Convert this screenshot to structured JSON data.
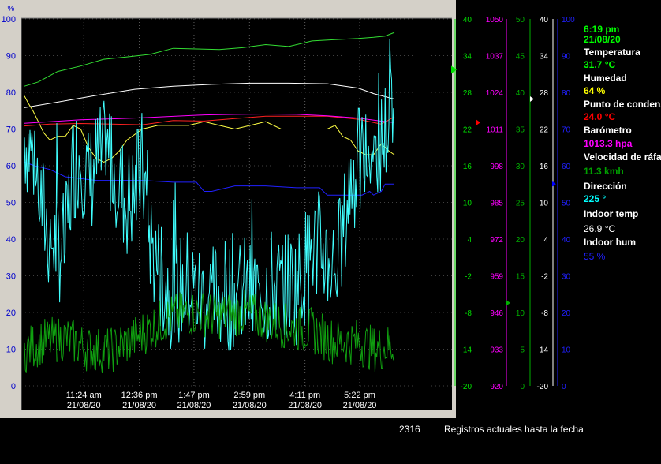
{
  "chart_data": {
    "type": "line",
    "left_axis": {
      "unit": "%",
      "ticks": [
        "100",
        "90",
        "80",
        "70",
        "60",
        "50",
        "40",
        "30",
        "20",
        "10",
        "0"
      ],
      "ylim": [
        0,
        100
      ]
    },
    "right_axes": [
      {
        "name": "temp",
        "color": "#00e000",
        "ticks": [
          "40",
          "34",
          "28",
          "22",
          "16",
          "10",
          "4",
          "-2",
          "-8",
          "-14",
          "-20"
        ],
        "ylim": [
          -20,
          40
        ]
      },
      {
        "name": "baro",
        "color": "#ff00ff",
        "ticks": [
          "1050",
          "1037",
          "1024",
          "1011",
          "998",
          "985",
          "972",
          "959",
          "946",
          "933",
          "920"
        ],
        "ylim": [
          920,
          1050
        ]
      },
      {
        "name": "wind",
        "color": "#00b000",
        "ticks": [
          "50",
          "45",
          "40",
          "35",
          "30",
          "25",
          "20",
          "15",
          "10",
          "5",
          "0"
        ],
        "ylim": [
          0,
          50
        ]
      },
      {
        "name": "indoor-temp",
        "color": "#ffffff",
        "ticks": [
          "40",
          "34",
          "28",
          "22",
          "16",
          "10",
          "4",
          "-2",
          "-8",
          "-14",
          "-20"
        ],
        "ylim": [
          -20,
          40
        ]
      },
      {
        "name": "indoor-hum",
        "color": "#2020ff",
        "ticks": [
          "100",
          "90",
          "80",
          "70",
          "60",
          "50",
          "40",
          "30",
          "20",
          "10",
          "0"
        ],
        "ylim": [
          0,
          100
        ]
      }
    ],
    "x_time_labels": [
      "11:24 am",
      "12:36 pm",
      "1:47 pm",
      "2:59 pm",
      "4:11 pm",
      "5:22 pm"
    ],
    "x_date_labels": [
      "21/08/20",
      "21/08/20",
      "21/08/20",
      "21/08/20",
      "21/08/20",
      "21/08/20"
    ],
    "x_ticks_minutes": [
      684,
      756,
      827,
      899,
      971,
      1042
    ],
    "x_range_minutes": [
      607,
      1087
    ],
    "series": [
      {
        "key": "temperature",
        "color": "#33dd33",
        "axis": "temp",
        "x": [
          607,
          625,
          650,
          680,
          710,
          740,
          770,
          800,
          830,
          860,
          890,
          920,
          950,
          980,
          1010,
          1040,
          1060,
          1075,
          1087
        ],
        "values": [
          29,
          29.7,
          31.4,
          32.3,
          33.4,
          33.8,
          34.2,
          35.2,
          35.1,
          35.0,
          35.3,
          35.8,
          35.5,
          36.4,
          36.6,
          36.8,
          37.0,
          37.2,
          37.8
        ]
      },
      {
        "key": "humidity",
        "color": "#ffff44",
        "axis": "pct",
        "x": [
          607,
          612,
          618,
          625,
          632,
          640,
          650,
          660,
          670,
          680,
          690,
          700,
          710,
          720,
          730,
          740,
          760,
          780,
          800,
          820,
          840,
          860,
          880,
          900,
          920,
          940,
          960,
          980,
          1000,
          1010,
          1020,
          1030,
          1040,
          1050,
          1060,
          1070,
          1080,
          1087
        ],
        "values": [
          79,
          77,
          75,
          72,
          69,
          67,
          68,
          68,
          71,
          70,
          65,
          62,
          61,
          62,
          64,
          67,
          70,
          71,
          71,
          71,
          72,
          71,
          70,
          71,
          72,
          70,
          70,
          70,
          70,
          71,
          68,
          67,
          64,
          63,
          63,
          66,
          64,
          63
        ]
      },
      {
        "key": "dew-point",
        "color": "#ff2020",
        "axis": "temp",
        "x": [
          607,
          640,
          680,
          720,
          760,
          800,
          840,
          880,
          920,
          960,
          1000,
          1040,
          1070,
          1087
        ],
        "values": [
          22.5,
          22.8,
          22.9,
          22.8,
          22.7,
          23.4,
          23.3,
          23.7,
          24.1,
          24.1,
          24.1,
          23.6,
          22.8,
          24.0
        ]
      },
      {
        "key": "barometer",
        "color": "#ff00ff",
        "axis": "baro",
        "x": [
          607,
          640,
          680,
          720,
          760,
          800,
          840,
          880,
          920,
          960,
          1000,
          1040,
          1070,
          1087
        ],
        "values": [
          1013.0,
          1013.6,
          1014.3,
          1014.6,
          1015.0,
          1015.5,
          1016.0,
          1016.2,
          1016.3,
          1016.2,
          1015.7,
          1014.9,
          1013.8,
          1013.3
        ]
      },
      {
        "key": "indoor-temp",
        "color": "#ffffff",
        "axis": "temp",
        "x": [
          607,
          650,
          700,
          750,
          800,
          850,
          900,
          950,
          1000,
          1040,
          1060,
          1087
        ],
        "values": [
          25.5,
          26.4,
          27.5,
          28.5,
          29.0,
          29.3,
          29.5,
          29.5,
          29.4,
          28.7,
          27.8,
          26.9
        ]
      },
      {
        "key": "indoor-hum",
        "color": "#2020ff",
        "axis": "pct",
        "x": [
          607,
          620,
          640,
          660,
          700,
          760,
          800,
          830,
          840,
          850,
          880,
          920,
          960,
          990,
          1000,
          1010,
          1030,
          1045,
          1055,
          1060,
          1070,
          1075,
          1087
        ],
        "values": [
          61,
          60,
          59,
          57,
          56,
          56,
          55.5,
          55.5,
          53,
          53,
          54.5,
          54.5,
          54,
          54,
          52,
          52,
          52,
          52,
          53,
          52,
          53,
          55,
          55
        ]
      },
      {
        "key": "wind-gust",
        "color": "#40ffff",
        "axis": "pct",
        "style": "noisy",
        "x": [
          607,
          620,
          630,
          640,
          650,
          660,
          670,
          680,
          690,
          700,
          710,
          720,
          730,
          740,
          750,
          760,
          770,
          780,
          790,
          800,
          810,
          820,
          830,
          840,
          850,
          860,
          870,
          880,
          890,
          900,
          910,
          920,
          930,
          940,
          950,
          960,
          970,
          980,
          990,
          1000,
          1010,
          1020,
          1030,
          1040,
          1050,
          1060,
          1070,
          1080,
          1087
        ],
        "values": [
          68,
          62,
          48,
          40,
          38,
          38,
          60,
          64,
          55,
          60,
          62,
          62,
          55,
          50,
          52,
          60,
          40,
          32,
          28,
          25,
          26,
          28,
          25,
          24,
          24,
          25,
          25,
          26,
          26,
          24,
          25,
          26,
          28,
          26,
          28,
          27,
          32,
          38,
          38,
          35,
          33,
          40,
          56,
          60,
          62,
          64,
          66,
          72,
          78
        ]
      },
      {
        "key": "wind-speed",
        "color": "#10a010",
        "axis": "wind",
        "style": "noisy",
        "x": [
          607,
          630,
          660,
          690,
          720,
          750,
          780,
          800,
          830,
          860,
          890,
          920,
          950,
          980,
          1010,
          1040,
          1060,
          1087
        ],
        "values": [
          4.8,
          6,
          6.5,
          5,
          4.8,
          6.5,
          8.5,
          9.5,
          10,
          9.5,
          10,
          9,
          8,
          7.5,
          6,
          6,
          5,
          5.5
        ]
      }
    ],
    "markers": [
      {
        "axis": "temp",
        "value": 31.7,
        "color": "#00e000",
        "shape": "big"
      },
      {
        "axis": "baro",
        "value": 1013.3,
        "color": "#ff0000"
      },
      {
        "axis": "wind",
        "value": 11.3,
        "color": "#00b000"
      },
      {
        "axis": "temp",
        "value": 26.9,
        "color": "#ffffff"
      },
      {
        "axis": "pct",
        "value": 55,
        "color": "#0000ff"
      }
    ]
  },
  "info_panel": {
    "time": "6:19 pm",
    "date": "21/08/20",
    "temperature_label": "Temperatura",
    "temperature_value": "31.7 °C",
    "humidity_label": "Humedad",
    "humidity_value": "64 %",
    "dewpoint_label": "Punto de condensación",
    "dewpoint_value": "24.0 °C",
    "barometer_label": "Barómetro",
    "barometer_value": "1013.3 hpa",
    "gust_label": "Velocidad de ráfaga",
    "gust_value": "11.3 kmh",
    "direction_label": "Dirección",
    "direction_value": "225 °",
    "indoor_temp_label": "Indoor temp",
    "indoor_temp_value": "26.9 °C",
    "indoor_hum_label": "Indoor hum",
    "indoor_hum_value": "55 %"
  },
  "status_bar": {
    "count": "2316",
    "message": "Registros actuales hasta la fecha"
  },
  "colors": {
    "window_gray": "#d4d0c8",
    "plot_bg": "#000000",
    "green_label": "#00ff00",
    "yellow_label": "#ffff00",
    "red_label": "#ff0000",
    "magenta_label": "#ff00ff",
    "cyan_label": "#00ffff"
  }
}
